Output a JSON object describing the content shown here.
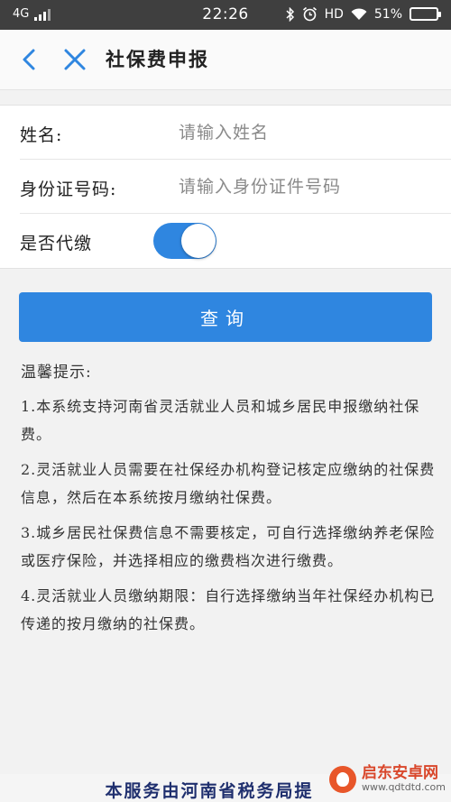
{
  "status_bar": {
    "network": "4G",
    "time": "22:26",
    "hd": "HD",
    "battery_percent": "51%",
    "battery_level": 0.51
  },
  "nav": {
    "title": "社保费申报"
  },
  "form": {
    "name_label": "姓名:",
    "name_placeholder": "请输入姓名",
    "id_label": "身份证号码:",
    "id_placeholder": "请输入身份证件号码",
    "proxy_label": "是否代缴",
    "proxy_enabled": true
  },
  "query_button": "查询",
  "tips": {
    "title": "温馨提示:",
    "items": [
      "1.本系统支持河南省灵活就业人员和城乡居民申报缴纳社保费。",
      "2.灵活就业人员需要在社保经办机构登记核定应缴纳的社保费信息，然后在本系统按月缴纳社保费。",
      "3.城乡居民社保费信息不需要核定，可自行选择缴纳养老保险或医疗保险，并选择相应的缴费档次进行缴费。",
      "4.灵活就业人员缴纳期限：自行选择缴纳当年社保经办机构已传递的按月缴纳的社保费。"
    ]
  },
  "footer_text": "本服务由河南省税务局提",
  "watermark": {
    "name": "启东安卓网",
    "url": "www.qdtdtd.com"
  },
  "colors": {
    "accent": "#2f86e0",
    "status_bar": "#3f3f3f",
    "footer_text": "#1f2f6e"
  }
}
